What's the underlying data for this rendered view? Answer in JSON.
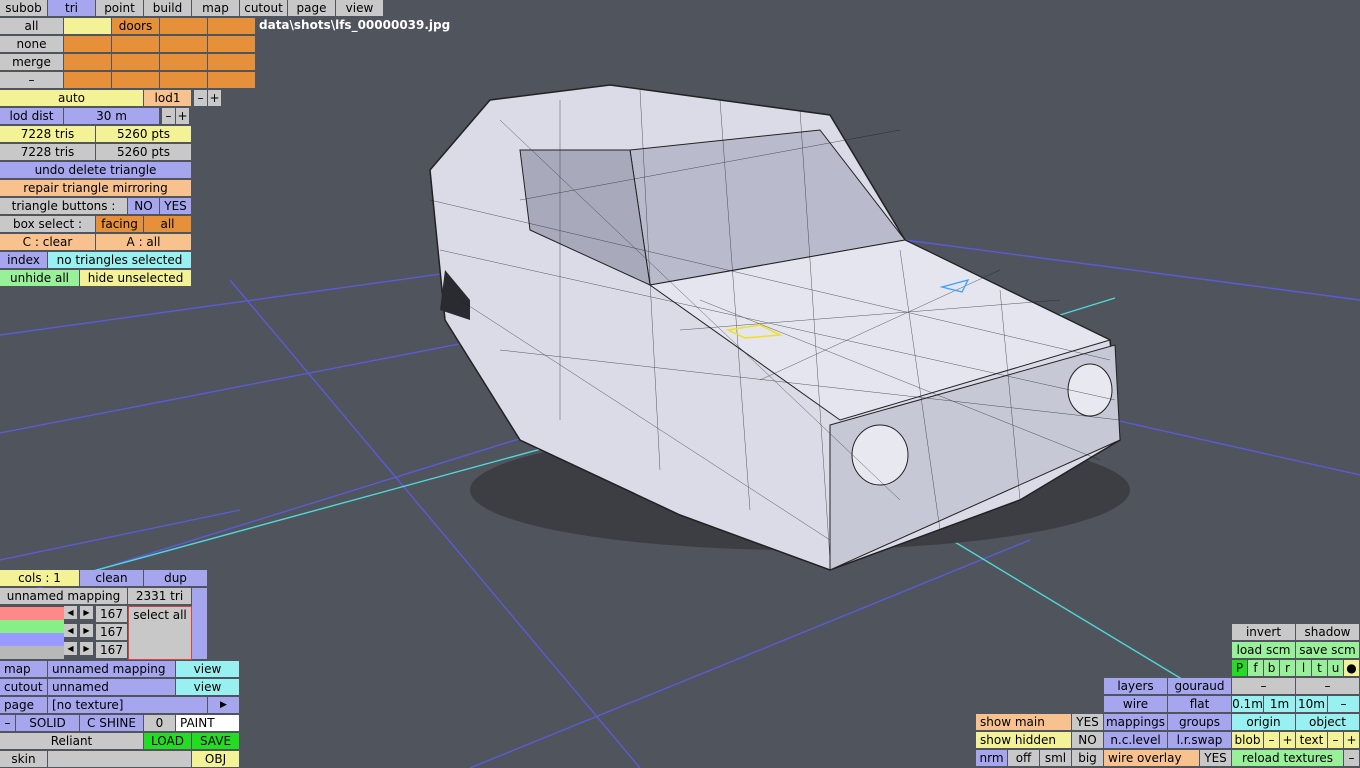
{
  "menu": {
    "tabs": [
      "subob",
      "tri",
      "point",
      "build",
      "map",
      "cutout",
      "page",
      "view"
    ],
    "active": "tri"
  },
  "file_path": "data\\shots\\lfs_00000039.jpg",
  "subobject_panel": {
    "rows": [
      "all",
      "none",
      "merge",
      "–"
    ],
    "grid_label": "doors"
  },
  "lod": {
    "auto": "auto",
    "lod": "lod1",
    "minus": "–",
    "plus": "+",
    "dist_label": "lod dist",
    "dist_value": "30 m"
  },
  "counts": {
    "tris_a": "7228 tris",
    "pts_a": "5260 pts",
    "tris_b": "7228 tris",
    "pts_b": "5260 pts"
  },
  "tri_tools": {
    "undo": "undo delete triangle",
    "repair": "repair triangle mirroring",
    "buttons_label": "triangle buttons :",
    "no": "NO",
    "yes": "YES",
    "box_select": "box select :",
    "facing": "facing",
    "all": "all",
    "c_clear": "C : clear",
    "a_all": "A : all",
    "index": "index",
    "selection_status": "no triangles selected",
    "unhide_all": "unhide all",
    "hide_unselected": "hide unselected"
  },
  "mapping_panel": {
    "cols": "cols : 1",
    "clean": "clean",
    "dup": "dup",
    "mapping_name": "unnamed mapping",
    "tri_count": "2331 tri",
    "select_all": "select all",
    "color_values": [
      "167",
      "167",
      "167"
    ],
    "arrow_left": "◀",
    "arrow_right": "▶",
    "map_label": "map",
    "map_value": "unnamed mapping",
    "view": "view",
    "cutout_label": "cutout",
    "cutout_value": "unnamed",
    "page_label": "page",
    "page_value": "[no texture]",
    "page_arrow": "▶",
    "solid": "SOLID",
    "c_shine": "C SHINE",
    "zero": "0",
    "paint": "PAINT",
    "model_name": "Reliant",
    "load": "LOAD",
    "save": "SAVE",
    "skin": "skin",
    "obj": "OBJ"
  },
  "view_panel": {
    "invert": "invert",
    "shadow": "shadow",
    "load_scm": "load scm",
    "save_scm": "save scm",
    "view_letters": [
      "P",
      "f",
      "b",
      "r",
      "l",
      "t",
      "u",
      "●"
    ],
    "layers": "layers",
    "gouraud": "gouraud",
    "wire": "wire",
    "flat": "flat",
    "step_01": "0.1m",
    "step_1": "1m",
    "step_10": "10m",
    "dash": "–",
    "show_main": "show main",
    "show_main_val": "YES",
    "show_hidden": "show hidden",
    "show_hidden_val": "NO",
    "mappings": "mappings",
    "groups": "groups",
    "origin": "origin",
    "object": "object",
    "nc_level": "n.c.level",
    "lr_swap": "l.r.swap",
    "blob": "blob",
    "text": "text",
    "minus": "–",
    "plus": "+",
    "nrm": "nrm",
    "off": "off",
    "sml": "sml",
    "big": "big",
    "wire_overlay": "wire overlay",
    "wire_overlay_val": "YES",
    "reload_textures": "reload textures"
  },
  "colors": {
    "background": "#50545c",
    "grid": "#5b5bd6",
    "axis": "#4fd8d8",
    "car_body": "#dadbe6",
    "mesh": "#1c1c22"
  }
}
